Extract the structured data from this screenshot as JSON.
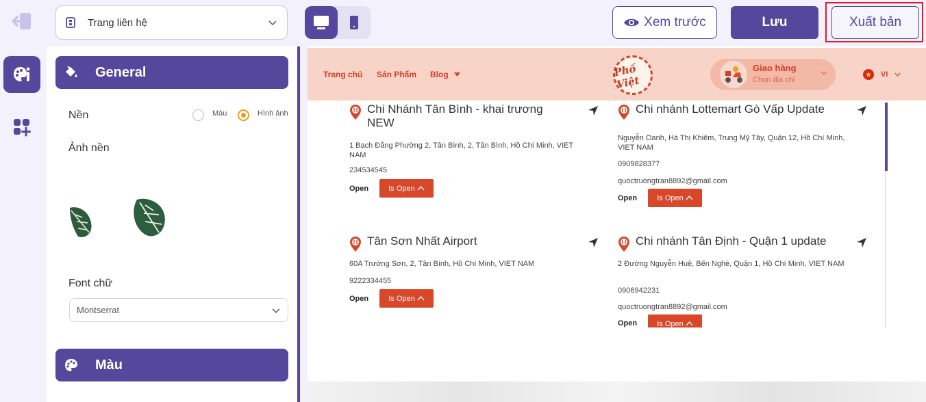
{
  "topbar": {
    "page_select": {
      "value": "Trang liên hệ"
    },
    "preview_label": "Xem trước",
    "save_label": "Lưu",
    "publish_label": "Xuất bản"
  },
  "rail": {
    "items": [
      "theme-settings",
      "add-section"
    ]
  },
  "panel": {
    "general_title": "General",
    "background_label": "Nền",
    "background_options": [
      "Màu",
      "Hình ảnh"
    ],
    "background_selected": "Hình ảnh",
    "bg_image_label": "Ảnh nền",
    "font_label": "Font chữ",
    "font_value": "Montserrat",
    "color_title": "Màu"
  },
  "preview": {
    "nav": [
      "Trang chủ",
      "Sản Phẩm",
      "Blog"
    ],
    "logo_text": "Phố Việt",
    "delivery_title": "Giao hàng",
    "delivery_sub": "Chọn địa chỉ",
    "lang": "VI",
    "branches": [
      {
        "name": "Chi Nhánh Tân Bình - khai trương NEW",
        "address": "1 Bạch Đằng Phường 2, Tân Bình, 2, Tân Bình, Hồ Chí Minh, VIET NAM",
        "phone": "234534545",
        "open_label": "Open",
        "status": "Is Open"
      },
      {
        "name": "Chi nhánh Lottemart Gò Vấp Update",
        "address": "Nguyễn Oanh, Hà Thị Khiêm, Trung Mỹ Tây, Quận 12, Hồ Chí Minh, VIET NAM",
        "phone": "0909828377",
        "email": "quoctruongtran8892@gmail.com",
        "open_label": "Open",
        "status": "Is Open"
      },
      {
        "name": "Tân Sơn Nhất Airport",
        "address": "60A Trường Sơn, 2, Tân Bình, Hồ Chí Minh, VIET NAM",
        "phone": "9222334455",
        "open_label": "Open",
        "status": "Is Open"
      },
      {
        "name": "Chi nhánh Tân Định - Quận 1 update",
        "address": "2 Đường Nguyễn Huệ, Bến Nghé, Quận 1, Hồ Chí Minh, VIET NAM",
        "phone": "0906942231",
        "email": "quoctruongtran8892@gmail.com",
        "open_label": "Open",
        "status": "Is Open"
      }
    ]
  },
  "colors": {
    "primary": "#55479c",
    "brand": "#d8472a",
    "highlight": "#e11a22",
    "header_bg": "#f8d3c7"
  }
}
